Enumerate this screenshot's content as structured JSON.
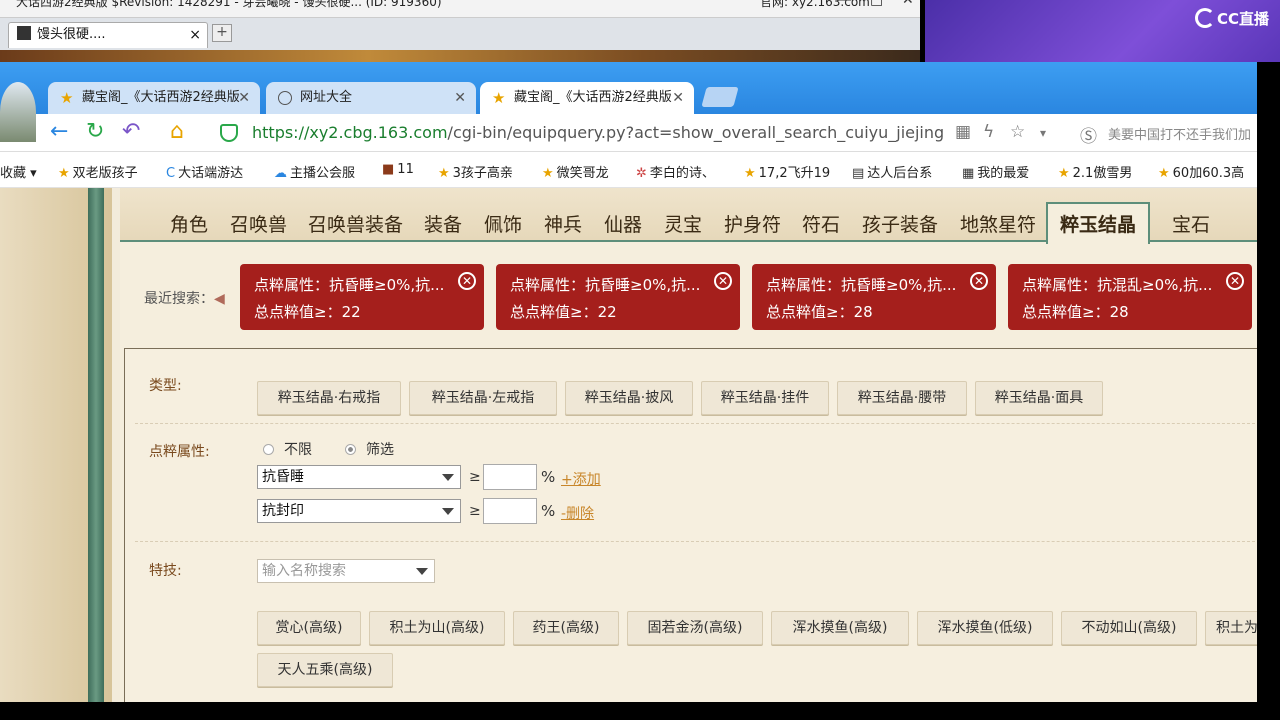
{
  "outer": {
    "title_left": "大话西游2经典版 $Revision: 1428291 - 芽芸曦晓 - 馒头很硬... (ID: 919360)",
    "title_right": "官网: xy2.163.com",
    "tab_label": "馒头很硬....",
    "minimize": "—",
    "maximize": "□",
    "close": "✕",
    "plus": "+"
  },
  "overlay": {
    "logo_text": "CC直播"
  },
  "browser": {
    "tabs": [
      {
        "label": "藏宝阁_《大话西游2经典版",
        "icon": "star-chick-icon"
      },
      {
        "label": "网址大全",
        "icon": "globe-icon"
      },
      {
        "label": "藏宝阁_《大话西游2经典版",
        "icon": "star-chick-icon"
      }
    ],
    "url_host": "https://xy2.cbg.163.com",
    "url_path": "/cgi-bin/equipquery.py?act=show_overall_search_cuiyu_jiejing",
    "search_hint": "美要中国打不还手我们加",
    "bookmarks": [
      "收藏",
      "双老版孩子",
      "大话端游达",
      "主播公会服",
      "11",
      "3孩子高亲",
      "微笑哥龙",
      "李白的诗、",
      "17,2飞升19",
      "达人后台系",
      "我的最爱",
      "2.1傲雪男",
      "60加60.3高"
    ]
  },
  "categories": [
    "角色",
    "召唤兽",
    "召唤兽装备",
    "装备",
    "佩饰",
    "神兵",
    "仙器",
    "灵宝",
    "护身符",
    "符石",
    "孩子装备",
    "地煞星符",
    "粹玉结晶",
    "宝石"
  ],
  "active_category": "粹玉结晶",
  "recent": {
    "label": "最近搜索：",
    "chips": [
      {
        "line1": "点粹属性：抗昏睡≥0%,抗...",
        "line2": "总点粹值≥：22"
      },
      {
        "line1": "点粹属性：抗昏睡≥0%,抗...",
        "line2": "总点粹值≥：22"
      },
      {
        "line1": "点粹属性：抗昏睡≥0%,抗...",
        "line2": "总点粹值≥：28"
      },
      {
        "line1": "点粹属性：抗混乱≥0%,抗...",
        "line2": "总点粹值≥：28"
      }
    ]
  },
  "filters": {
    "type_label": "类型:",
    "types": [
      "粹玉结晶·右戒指",
      "粹玉结晶·左戒指",
      "粹玉结晶·披风",
      "粹玉结晶·挂件",
      "粹玉结晶·腰带",
      "粹玉结晶·面具"
    ],
    "attr_label": "点粹属性:",
    "radio_unlimited": "不限",
    "radio_filter": "筛选",
    "attr_rows": [
      {
        "select": "抗昏睡",
        "geq": "≥",
        "value": "",
        "pct": "%",
        "action": "+添加"
      },
      {
        "select": "抗封印",
        "geq": "≥",
        "value": "",
        "pct": "%",
        "action": "-删除"
      }
    ],
    "skill_label": "特技:",
    "skill_placeholder": "输入名称搜索",
    "skills": [
      "赏心(高级)",
      "积土为山(高级)",
      "药王(高级)",
      "固若金汤(高级)",
      "浑水摸鱼(高级)",
      "浑水摸鱼(低级)",
      "不动如山(高级)",
      "积土为",
      "天人五乘(高级)"
    ]
  }
}
